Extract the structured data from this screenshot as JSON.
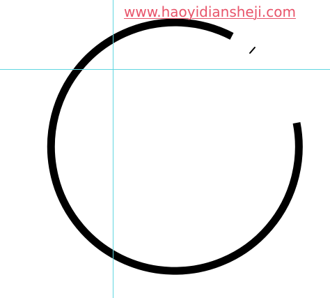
{
  "watermark": {
    "text": "www.haoyidiansheji.com",
    "color": "#e8546a"
  },
  "canvas": {
    "background": "#ffffff"
  },
  "guides": {
    "color": "#5fd6e0",
    "count_vertical": 1,
    "count_horizontal": 1
  },
  "drawing": {
    "shape": "open-circle-stroke",
    "stroke_color": "#000000",
    "has_broken_gap": true,
    "has_stray_fragment": true
  }
}
